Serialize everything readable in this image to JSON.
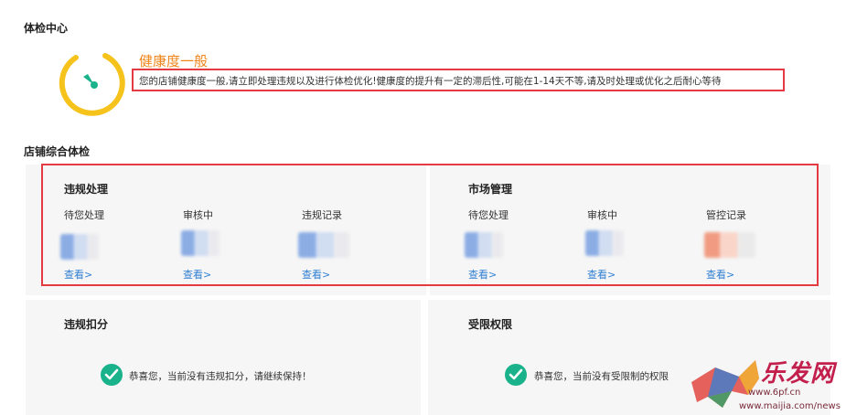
{
  "header": {
    "title": "体检中心"
  },
  "health": {
    "status": "健康度一般",
    "description": "您的店铺健康度一般,请立即处理违规以及进行体检优化!健康度的提升有一定的滞后性,可能在1-14天不等,请及时处理或优化之后耐心等待",
    "gauge_color": "#f5c31b",
    "needle_color": "#19b28a",
    "status_color": "#f08519"
  },
  "store_check": {
    "title": "店铺综合体检",
    "violation": {
      "title": "违规处理",
      "columns": [
        {
          "label": "待您处理",
          "link": "查看>"
        },
        {
          "label": "审核中",
          "link": "查看>"
        },
        {
          "label": "违规记录",
          "link": "查看>"
        }
      ]
    },
    "market": {
      "title": "市场管理",
      "columns": [
        {
          "label": "待您处理",
          "link": "查看>"
        },
        {
          "label": "审核中",
          "link": "查看>"
        },
        {
          "label": "管控记录",
          "link": "查看>"
        }
      ]
    },
    "deduction": {
      "title": "违规扣分",
      "message": "恭喜您，当前没有违规扣分，请继续保持！"
    },
    "restriction": {
      "title": "受限权限",
      "message": "恭喜您，当前没有受限制的权限"
    }
  },
  "watermark": {
    "brand": "乐发网",
    "url": "www.6pf.cn",
    "url2": "www.maijia.com/news"
  },
  "colors": {
    "highlight_border": "#e63a43",
    "link": "#2f7fd4",
    "check": "#19b28a"
  }
}
